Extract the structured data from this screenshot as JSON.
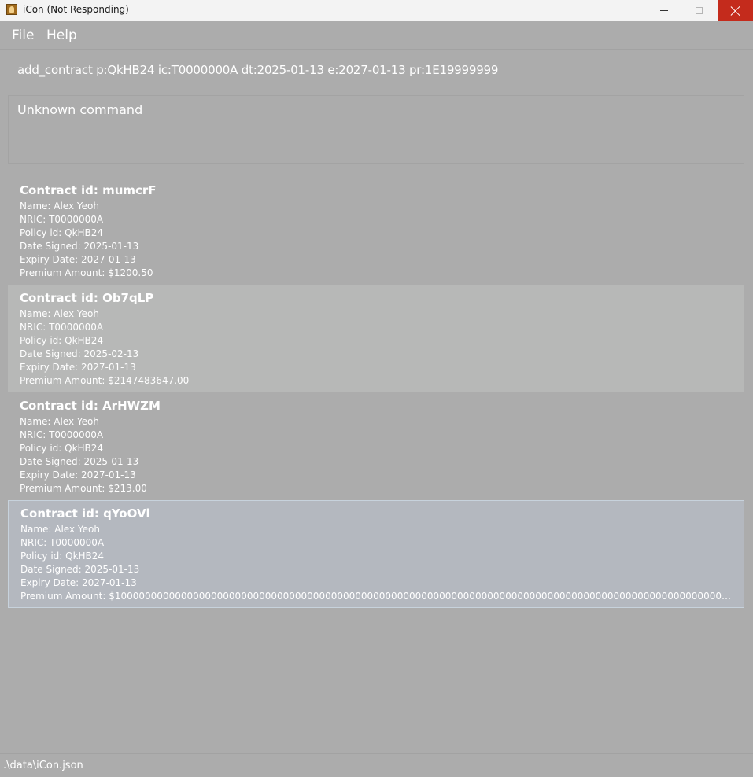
{
  "window": {
    "title": "iCon (Not Responding)",
    "icon": "app-icon"
  },
  "menu": {
    "file": "File",
    "help": "Help"
  },
  "command": {
    "value": "add_contract p:QkHB24 ic:T0000000A dt:2025-01-13 e:2027-01-13 pr:1E19999999"
  },
  "result": {
    "text": "Unknown command"
  },
  "contracts": [
    {
      "title": "Contract id: mumcrF",
      "name": "Name: Alex Yeoh",
      "nric": "NRIC: T0000000A",
      "policy": "Policy id: QkHB24",
      "date_signed": "Date Signed: 2025-01-13",
      "expiry": "Expiry Date: 2027-01-13",
      "premium": "Premium Amount: $1200.50"
    },
    {
      "title": "Contract id: Ob7qLP",
      "name": "Name: Alex Yeoh",
      "nric": "NRIC: T0000000A",
      "policy": "Policy id: QkHB24",
      "date_signed": "Date Signed: 2025-02-13",
      "expiry": "Expiry Date: 2027-01-13",
      "premium": "Premium Amount: $2147483647.00"
    },
    {
      "title": "Contract id: ArHWZM",
      "name": "Name: Alex Yeoh",
      "nric": "NRIC: T0000000A",
      "policy": "Policy id: QkHB24",
      "date_signed": "Date Signed: 2025-01-13",
      "expiry": "Expiry Date: 2027-01-13",
      "premium": "Premium Amount: $213.00"
    },
    {
      "title": "Contract id: qYoOVl",
      "name": "Name: Alex Yeoh",
      "nric": "NRIC: T0000000A",
      "policy": "Policy id: QkHB24",
      "date_signed": "Date Signed: 2025-01-13",
      "expiry": "Expiry Date: 2027-01-13",
      "premium": "Premium Amount: $1000000000000000000000000000000000000000000000000000000000000000000000000000000000000000000000000000000000000000000000000000000000000..."
    }
  ],
  "status": {
    "path": ".\\data\\iCon.json"
  },
  "colors": {
    "background": "#acacac",
    "close_button": "#c42b1c",
    "selected_card": "#b4b8bf"
  }
}
